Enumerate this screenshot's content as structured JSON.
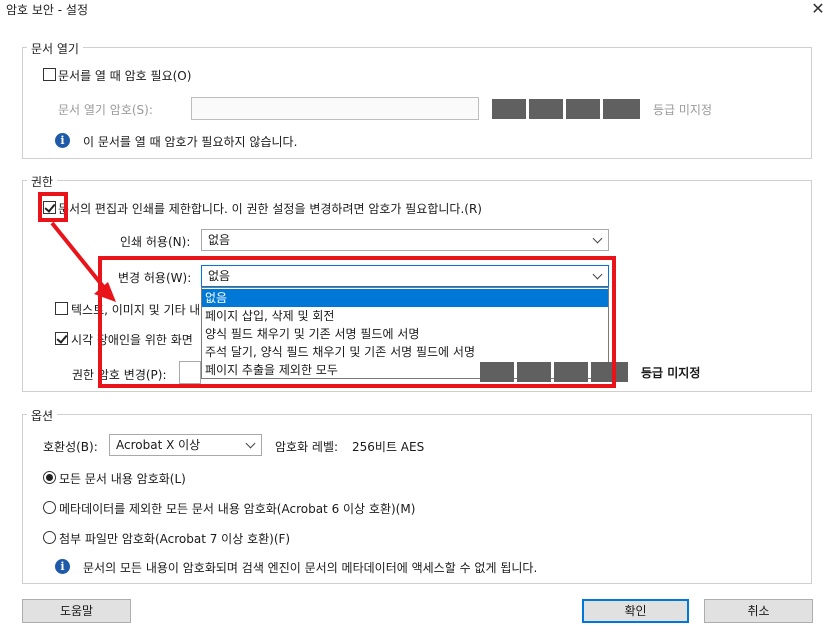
{
  "window": {
    "title": "암호 보안 - 설정",
    "close_glyph": "✕"
  },
  "open_group": {
    "label": "문서 열기",
    "require_pw_label": "문서를 열 때 암호 필요(O)",
    "pw_field_label": "문서 열기 암호(S):",
    "strength": "등급 미지정",
    "info": "이 문서를 열 때 암호가 필요하지 않습니다."
  },
  "perm_group": {
    "label": "권한",
    "restrict_label": "문서의 편집과 인쇄를 제한합니다. 이 권한 설정을 변경하려면 암호가 필요합니다.(R)",
    "print_label": "인쇄 허용(N):",
    "print_value": "없음",
    "change_label": "변경 허용(W):",
    "change_value": "없음",
    "text_copy_label": "텍스트, 이미지 및 기타 내",
    "screen_reader_label": "시각 장애인을 위한 화면",
    "perm_pw_label": "권한 암호 변경(P):",
    "strength": "등급 미지정",
    "dropdown_options": [
      "없음",
      "페이지 삽입, 삭제 및 회전",
      "양식 필드 채우기 및 기존 서명 필드에 서명",
      "주석 달기, 양식 필드 채우기 및 기존 서명 필드에 서명",
      "페이지 추출을 제외한 모두"
    ]
  },
  "options_group": {
    "label": "옵션",
    "compat_label": "호환성(B):",
    "compat_value": "Acrobat X 이상",
    "enc_level_label": "암호화 레벨:",
    "enc_level_value": "256비트 AES",
    "radio_all": "모든 문서 내용 암호화(L)",
    "radio_except_meta": "메타데이터를 제외한 모든 문서 내용 암호화(Acrobat 6 이상 호환)(M)",
    "radio_attach": "첨부 파일만 암호화(Acrobat 7 이상 호환)(F)",
    "info": "문서의 모든 내용이 암호화되며 검색 엔진이 문서의 메타데이터에 액세스할 수 없게 됩니다."
  },
  "buttons": {
    "help": "도움말",
    "ok": "확인",
    "cancel": "취소"
  },
  "colors": {
    "highlight": "#e8141a",
    "selection": "#0078d7",
    "info_icon": "#1e5aa8"
  }
}
